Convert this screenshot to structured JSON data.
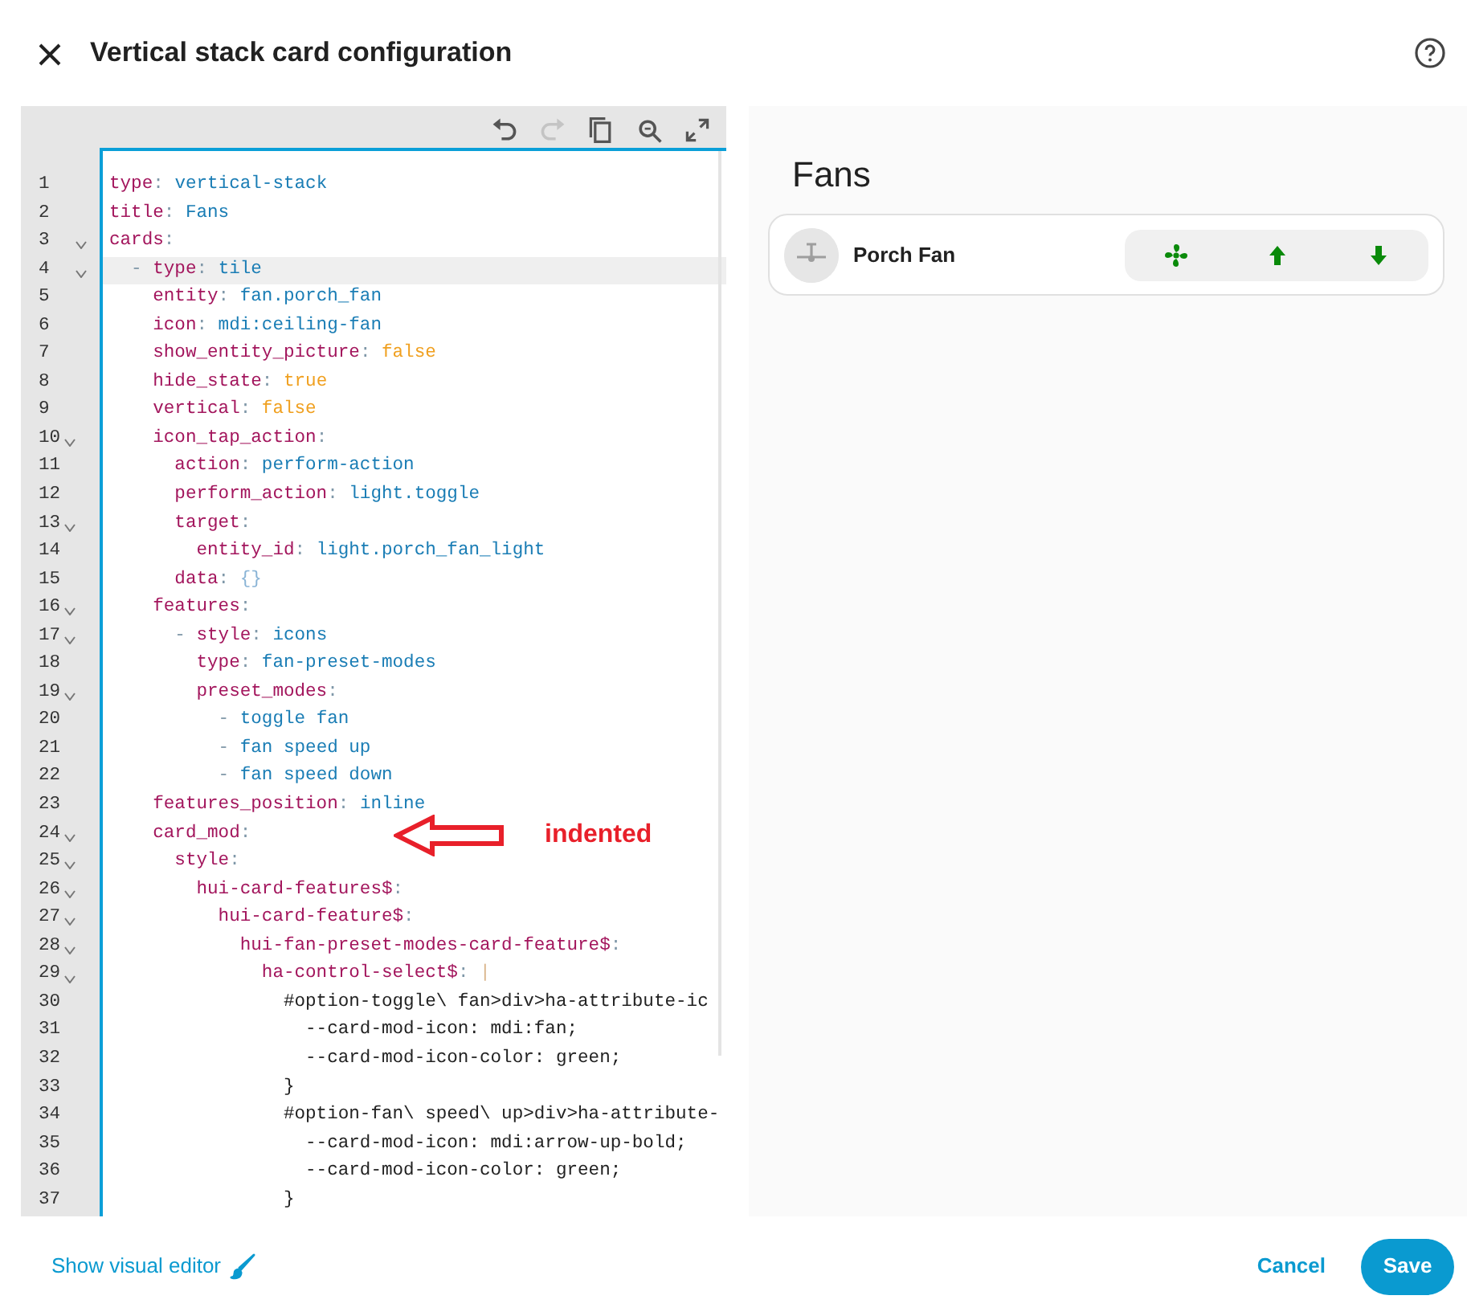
{
  "dialog": {
    "title": "Vertical stack card configuration"
  },
  "editor": {
    "toolbar": [
      {
        "kind": "undo",
        "disabled": false
      },
      {
        "kind": "redo",
        "disabled": true
      },
      {
        "kind": "copy",
        "disabled": false
      },
      {
        "kind": "search",
        "disabled": false
      },
      {
        "kind": "fullscreen",
        "disabled": false
      }
    ],
    "lines": [
      {
        "number": "1",
        "fold": false,
        "current": false,
        "tokens": [
          {
            "kind": "key",
            "text": "type"
          },
          {
            "kind": "punct",
            "text": ": "
          },
          {
            "kind": "value",
            "text": "vertical-stack"
          }
        ]
      },
      {
        "number": "2",
        "fold": false,
        "current": false,
        "tokens": [
          {
            "kind": "key",
            "text": "title"
          },
          {
            "kind": "punct",
            "text": ": "
          },
          {
            "kind": "value",
            "text": "Fans"
          }
        ]
      },
      {
        "number": "3",
        "fold": true,
        "current": false,
        "tokens": [
          {
            "kind": "key",
            "text": "cards"
          },
          {
            "kind": "punct",
            "text": ":"
          }
        ]
      },
      {
        "number": "4",
        "fold": true,
        "current": true,
        "tokens": [
          {
            "kind": "punct",
            "text": "  - "
          },
          {
            "kind": "key",
            "text": "type"
          },
          {
            "kind": "punct",
            "text": ": "
          },
          {
            "kind": "value",
            "text": "tile"
          }
        ]
      },
      {
        "number": "5",
        "fold": false,
        "current": false,
        "tokens": [
          {
            "kind": "key",
            "text": "    entity"
          },
          {
            "kind": "punct",
            "text": ": "
          },
          {
            "kind": "value",
            "text": "fan.porch_fan"
          }
        ]
      },
      {
        "number": "6",
        "fold": false,
        "current": false,
        "tokens": [
          {
            "kind": "key",
            "text": "    icon"
          },
          {
            "kind": "punct",
            "text": ": "
          },
          {
            "kind": "value",
            "text": "mdi:ceiling-fan"
          }
        ]
      },
      {
        "number": "7",
        "fold": false,
        "current": false,
        "tokens": [
          {
            "kind": "key",
            "text": "    show_entity_picture"
          },
          {
            "kind": "punct",
            "text": ": "
          },
          {
            "kind": "bool",
            "text": "false"
          }
        ]
      },
      {
        "number": "8",
        "fold": false,
        "current": false,
        "tokens": [
          {
            "kind": "key",
            "text": "    hide_state"
          },
          {
            "kind": "punct",
            "text": ": "
          },
          {
            "kind": "bool",
            "text": "true"
          }
        ]
      },
      {
        "number": "9",
        "fold": false,
        "current": false,
        "tokens": [
          {
            "kind": "key",
            "text": "    vertical"
          },
          {
            "kind": "punct",
            "text": ": "
          },
          {
            "kind": "bool",
            "text": "false"
          }
        ]
      },
      {
        "number": "10",
        "fold": true,
        "current": false,
        "tokens": [
          {
            "kind": "key",
            "text": "    icon_tap_action"
          },
          {
            "kind": "punct",
            "text": ":"
          }
        ]
      },
      {
        "number": "11",
        "fold": false,
        "current": false,
        "tokens": [
          {
            "kind": "key",
            "text": "      action"
          },
          {
            "kind": "punct",
            "text": ": "
          },
          {
            "kind": "value",
            "text": "perform-action"
          }
        ]
      },
      {
        "number": "12",
        "fold": false,
        "current": false,
        "tokens": [
          {
            "kind": "key",
            "text": "      perform_action"
          },
          {
            "kind": "punct",
            "text": ": "
          },
          {
            "kind": "value",
            "text": "light.toggle"
          }
        ]
      },
      {
        "number": "13",
        "fold": true,
        "current": false,
        "tokens": [
          {
            "kind": "key",
            "text": "      target"
          },
          {
            "kind": "punct",
            "text": ":"
          }
        ]
      },
      {
        "number": "14",
        "fold": false,
        "current": false,
        "tokens": [
          {
            "kind": "key",
            "text": "        entity_id"
          },
          {
            "kind": "punct",
            "text": ": "
          },
          {
            "kind": "value",
            "text": "light.porch_fan_light"
          }
        ]
      },
      {
        "number": "15",
        "fold": false,
        "current": false,
        "tokens": [
          {
            "kind": "key",
            "text": "      data"
          },
          {
            "kind": "punct",
            "text": ": "
          },
          {
            "kind": "brace",
            "text": "{}"
          }
        ]
      },
      {
        "number": "16",
        "fold": true,
        "current": false,
        "tokens": [
          {
            "kind": "key",
            "text": "    features"
          },
          {
            "kind": "punct",
            "text": ":"
          }
        ]
      },
      {
        "number": "17",
        "fold": true,
        "current": false,
        "tokens": [
          {
            "kind": "punct",
            "text": "      - "
          },
          {
            "kind": "key",
            "text": "style"
          },
          {
            "kind": "punct",
            "text": ": "
          },
          {
            "kind": "value",
            "text": "icons"
          }
        ]
      },
      {
        "number": "18",
        "fold": false,
        "current": false,
        "tokens": [
          {
            "kind": "key",
            "text": "        type"
          },
          {
            "kind": "punct",
            "text": ": "
          },
          {
            "kind": "value",
            "text": "fan-preset-modes"
          }
        ]
      },
      {
        "number": "19",
        "fold": true,
        "current": false,
        "tokens": [
          {
            "kind": "key",
            "text": "        preset_modes"
          },
          {
            "kind": "punct",
            "text": ":"
          }
        ]
      },
      {
        "number": "20",
        "fold": false,
        "current": false,
        "tokens": [
          {
            "kind": "punct",
            "text": "          - "
          },
          {
            "kind": "value",
            "text": "toggle fan"
          }
        ]
      },
      {
        "number": "21",
        "fold": false,
        "current": false,
        "tokens": [
          {
            "kind": "punct",
            "text": "          - "
          },
          {
            "kind": "value",
            "text": "fan speed up"
          }
        ]
      },
      {
        "number": "22",
        "fold": false,
        "current": false,
        "tokens": [
          {
            "kind": "punct",
            "text": "          - "
          },
          {
            "kind": "value",
            "text": "fan speed down"
          }
        ]
      },
      {
        "number": "23",
        "fold": false,
        "current": false,
        "tokens": [
          {
            "kind": "key",
            "text": "    features_position"
          },
          {
            "kind": "punct",
            "text": ": "
          },
          {
            "kind": "value",
            "text": "inline"
          }
        ]
      },
      {
        "number": "24",
        "fold": true,
        "current": false,
        "tokens": [
          {
            "kind": "key",
            "text": "    card_mod"
          },
          {
            "kind": "punct",
            "text": ":"
          }
        ]
      },
      {
        "number": "25",
        "fold": true,
        "current": false,
        "tokens": [
          {
            "kind": "key",
            "text": "      style"
          },
          {
            "kind": "punct",
            "text": ":"
          }
        ]
      },
      {
        "number": "26",
        "fold": true,
        "current": false,
        "tokens": [
          {
            "kind": "key",
            "text": "        hui-card-features$"
          },
          {
            "kind": "punct",
            "text": ":"
          }
        ]
      },
      {
        "number": "27",
        "fold": true,
        "current": false,
        "tokens": [
          {
            "kind": "key",
            "text": "          hui-card-feature$"
          },
          {
            "kind": "punct",
            "text": ":"
          }
        ]
      },
      {
        "number": "28",
        "fold": true,
        "current": false,
        "tokens": [
          {
            "kind": "key",
            "text": "            hui-fan-preset-modes-card-feature$"
          },
          {
            "kind": "punct",
            "text": ":"
          }
        ]
      },
      {
        "number": "29",
        "fold": true,
        "current": false,
        "tokens": [
          {
            "kind": "key",
            "text": "              ha-control-select$"
          },
          {
            "kind": "punct",
            "text": ": "
          },
          {
            "kind": "block",
            "text": "|"
          }
        ]
      },
      {
        "number": "30",
        "fold": false,
        "current": false,
        "tokens": [
          {
            "kind": "plain",
            "text": "                #option-toggle\\ fan>div>ha-attribute-ic"
          }
        ]
      },
      {
        "number": "31",
        "fold": false,
        "current": false,
        "tokens": [
          {
            "kind": "plain",
            "text": "                  --card-mod-icon: mdi:fan;"
          }
        ]
      },
      {
        "number": "32",
        "fold": false,
        "current": false,
        "tokens": [
          {
            "kind": "plain",
            "text": "                  --card-mod-icon-color: green;"
          }
        ]
      },
      {
        "number": "33",
        "fold": false,
        "current": false,
        "tokens": [
          {
            "kind": "plain",
            "text": "                }"
          }
        ]
      },
      {
        "number": "34",
        "fold": false,
        "current": false,
        "tokens": [
          {
            "kind": "plain",
            "text": "                #option-fan\\ speed\\ up>div>ha-attribute-"
          }
        ]
      },
      {
        "number": "35",
        "fold": false,
        "current": false,
        "tokens": [
          {
            "kind": "plain",
            "text": "                  --card-mod-icon: mdi:arrow-up-bold;"
          }
        ]
      },
      {
        "number": "36",
        "fold": false,
        "current": false,
        "tokens": [
          {
            "kind": "plain",
            "text": "                  --card-mod-icon-color: green;"
          }
        ]
      },
      {
        "number": "37",
        "fold": false,
        "current": false,
        "tokens": [
          {
            "kind": "plain",
            "text": "                }"
          }
        ]
      }
    ],
    "annotation": {
      "text": "indented"
    }
  },
  "preview": {
    "title": "Fans",
    "tile": {
      "name": "Porch Fan"
    }
  },
  "footer": {
    "link": "Show visual editor",
    "cancel": "Cancel",
    "save": "Save"
  }
}
